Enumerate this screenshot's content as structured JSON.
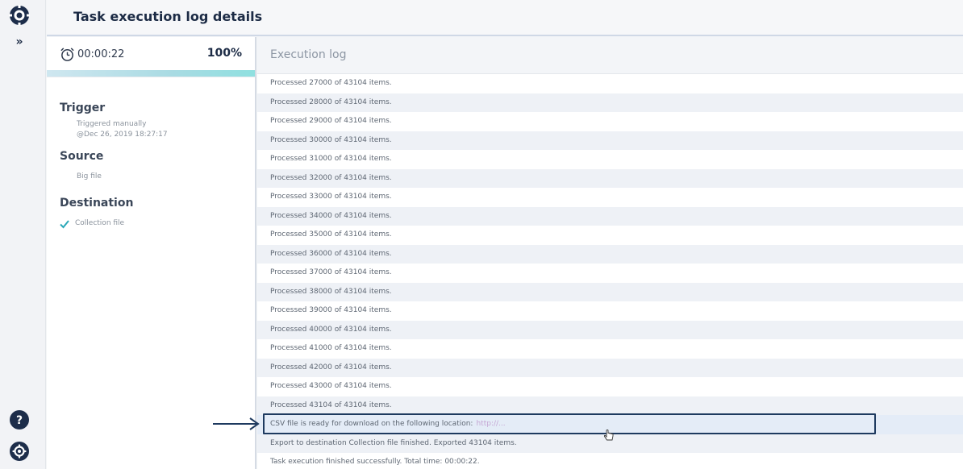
{
  "header": {
    "title": "Task execution log details"
  },
  "rail": {
    "expand_glyph": "»",
    "icons": [
      "logo-icon",
      "expand-icon",
      "help-icon",
      "settings-icon"
    ]
  },
  "summary": {
    "elapsed_time": "00:00:22",
    "progress_percent_label": "100%",
    "progress_fraction": 1.0,
    "trigger": {
      "heading": "Trigger",
      "line1": "Triggered manually",
      "line2": "@Dec 26, 2019 18:27:17"
    },
    "source": {
      "heading": "Source",
      "value": "Big file"
    },
    "destination": {
      "heading": "Destination",
      "value": "Collection file"
    }
  },
  "log": {
    "heading": "Execution log",
    "rows": [
      "Processed 27000 of 43104 items.",
      "Processed 28000 of 43104 items.",
      "Processed 29000 of 43104 items.",
      "Processed 30000 of 43104 items.",
      "Processed 31000 of 43104 items.",
      "Processed 32000 of 43104 items.",
      "Processed 33000 of 43104 items.",
      "Processed 34000 of 43104 items.",
      "Processed 35000 of 43104 items.",
      "Processed 36000 of 43104 items.",
      "Processed 37000 of 43104 items.",
      "Processed 38000 of 43104 items.",
      "Processed 39000 of 43104 items.",
      "Processed 40000 of 43104 items.",
      "Processed 41000 of 43104 items.",
      "Processed 42000 of 43104 items.",
      "Processed 43000 of 43104 items.",
      "Processed 43104 of 43104 items."
    ],
    "csv_row": {
      "text": "CSV file is ready for download on the following location:",
      "url_blurred": "http://..."
    },
    "after_rows": [
      "Export to destination Collection file finished. Exported 43104 items.",
      "Task execution finished successfully. Total time: 00:00:22."
    ]
  },
  "colors": {
    "accent_navy": "#1c2b45",
    "highlight_border": "#1e3a5f",
    "progress_fill": "#8fe0e0",
    "check_teal": "#2aa8b8"
  }
}
